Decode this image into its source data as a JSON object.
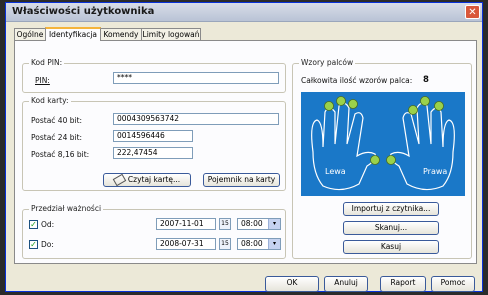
{
  "window": {
    "title": "Właściwości użytkownika",
    "close": "✕"
  },
  "tabs": [
    {
      "label": "Ogólne"
    },
    {
      "label": "Identyfikacja"
    },
    {
      "label": "Komendy"
    },
    {
      "label": "Limity logowań"
    }
  ],
  "pin": {
    "legend": "Kod PIN:",
    "label": "PIN:",
    "value": "****"
  },
  "card": {
    "legend": "Kod karty:",
    "rows": [
      {
        "label": "Postać 40 bit:",
        "value": "000430956374​2"
      },
      {
        "label": "Postać 24 bit:",
        "value": "0014596446"
      },
      {
        "label": "Postać 8,16 bit:",
        "value": "222,47454"
      }
    ],
    "read_button": "Czytaj kartę...",
    "capacity_button": "Pojemnik na karty"
  },
  "validity": {
    "legend": "Przedział ważności",
    "from_label": "Od:",
    "from_date": "2007-11-01",
    "from_time": "08:00",
    "to_label": "Do:",
    "to_date": "2008-07-31",
    "to_time": "08:00",
    "cal_glyph": "15",
    "dropdown_glyph": "▾",
    "check_glyph": "✓"
  },
  "fingers": {
    "legend": "Wzory palców",
    "total_label": "Całkowita ilość wzorów palca:",
    "total_value": "8",
    "left_label": "Lewa",
    "right_label": "Prawa"
  },
  "finger_actions": {
    "import": "Importuj z czytnika...",
    "scan": "Skanuj...",
    "delete": "Kasuj"
  },
  "footer": {
    "ok": "OK",
    "cancel": "Anuluj",
    "report": "Raport",
    "help": "Pomoc"
  },
  "colors": {
    "finger_panel": "#1a78c8",
    "finger_dot": "#9ad14b",
    "title_bar": "#b9c3d6"
  }
}
